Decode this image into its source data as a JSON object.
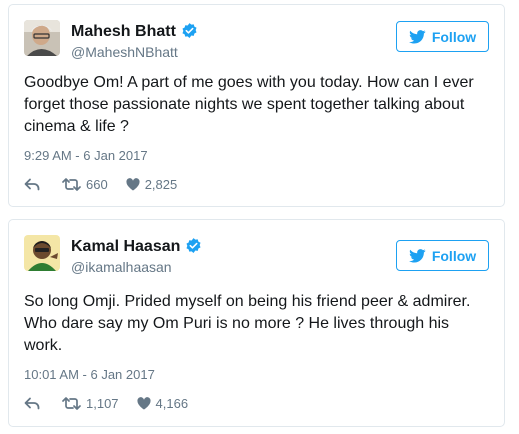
{
  "tweets": [
    {
      "name": "Mahesh Bhatt",
      "handle": "@MaheshNBhatt",
      "follow_label": "Follow",
      "text": "Goodbye Om! A part of me goes with you today. How can I ever forget those passionate nights we spent together talking about cinema & life ?",
      "timestamp": "9:29 AM - 6 Jan 2017",
      "retweets": "660",
      "likes": "2,825"
    },
    {
      "name": "Kamal Haasan",
      "handle": "@ikamalhaasan",
      "follow_label": "Follow",
      "text": "So long Omji. Prided myself on being his friend peer & admirer. Who dare say my Om Puri is no more ? He lives through his work.",
      "timestamp": "10:01 AM - 6 Jan 2017",
      "retweets": "1,107",
      "likes": "4,166"
    }
  ],
  "colors": {
    "accent": "#1da1f2",
    "secondary_text": "#657786",
    "border": "#e1e8ed"
  },
  "icons": [
    "twitter-bird-icon",
    "verified-badge-icon",
    "reply-icon",
    "retweet-icon",
    "like-icon"
  ]
}
